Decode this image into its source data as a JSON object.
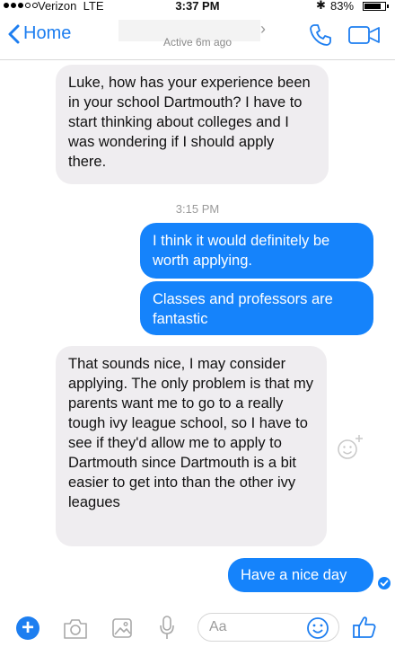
{
  "status_bar": {
    "carrier": "Verizon",
    "network": "LTE",
    "time": "3:37 PM",
    "battery_percent": "83%",
    "battery_level": 0.83
  },
  "header": {
    "back_label": "Home",
    "active_status": "Active 6m ago"
  },
  "thread": {
    "messages": [
      {
        "sender": "other",
        "text": "Luke, how has your experience been in your school Dartmouth? I have to start thinking about colleges and I was wondering if I should apply there."
      },
      {
        "sender": "me",
        "text": "I think it would definitely be worth applying."
      },
      {
        "sender": "me",
        "text": "Classes and professors are fantastic"
      },
      {
        "sender": "other",
        "text": "That sounds nice, I may consider applying.  The only problem is that my parents want me to go to a really tough ivy league school, so I have to see if they'd allow me to apply to Dartmouth since Dartmouth is a bit easier to get into than the other ivy leagues"
      },
      {
        "sender": "me",
        "text": "Have a nice day"
      }
    ],
    "timestamp": "3:15 PM"
  },
  "composer": {
    "placeholder": "Aa"
  },
  "colors": {
    "accent": "#1d7ef0",
    "outgoing_bubble": "#1583fb",
    "incoming_bubble": "#efedf0"
  }
}
